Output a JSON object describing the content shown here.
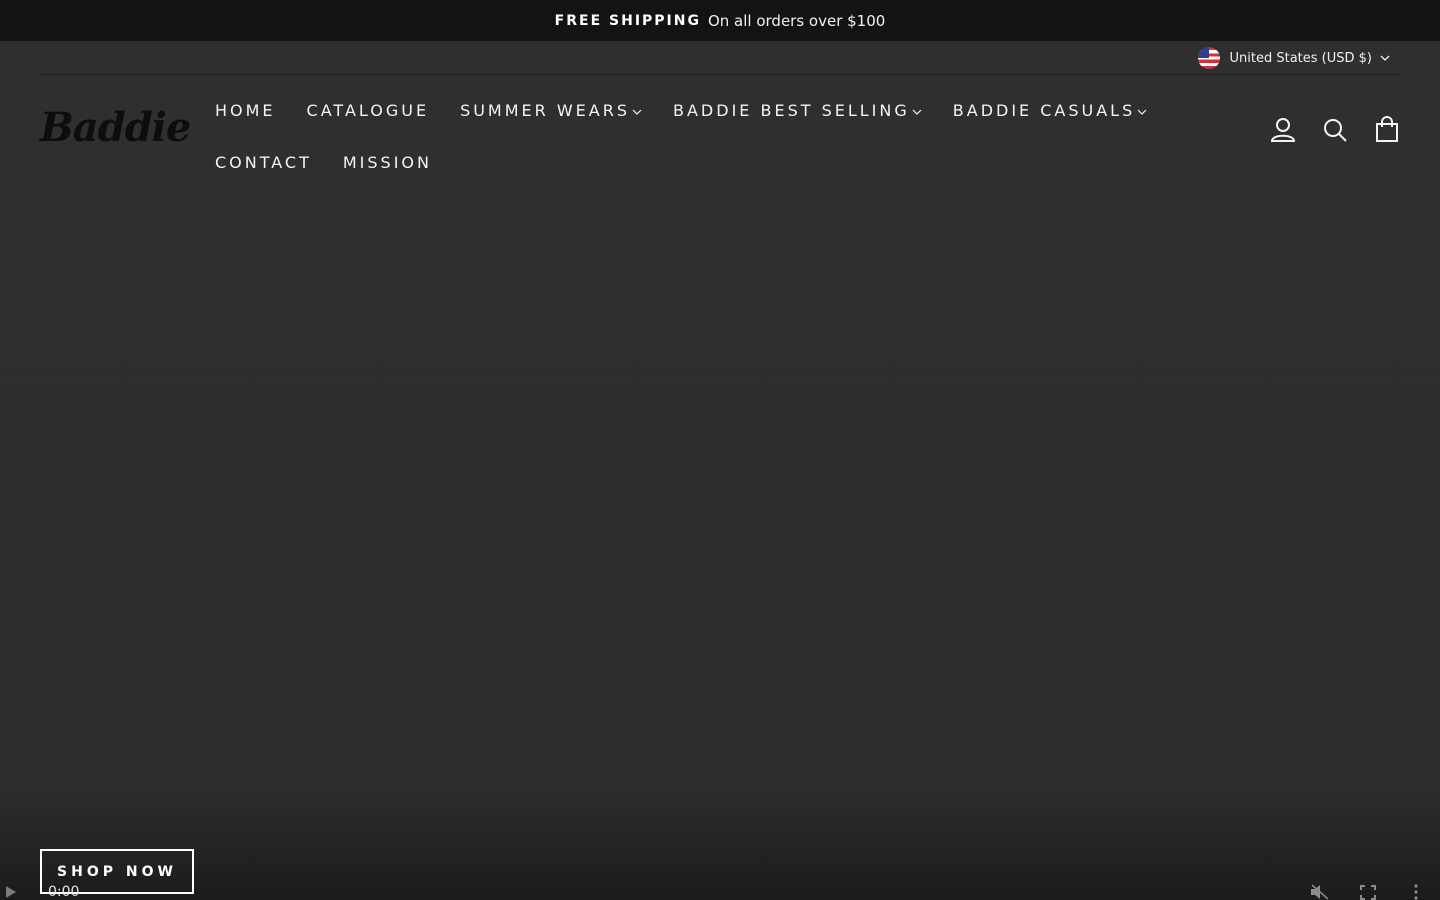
{
  "announcement": {
    "bold": "FREE SHIPPING",
    "text": "On all orders over $100"
  },
  "locale": {
    "label": "United States (USD $)",
    "icon": "us-flag-icon"
  },
  "brand": {
    "logo_text": "Baddie"
  },
  "nav": {
    "items": [
      {
        "label": "HOME",
        "dropdown": false
      },
      {
        "label": "CATALOGUE",
        "dropdown": false
      },
      {
        "label": "SUMMER WEARS",
        "dropdown": true
      },
      {
        "label": "BADDIE BEST SELLING",
        "dropdown": true
      },
      {
        "label": "BADDIE CASUALS",
        "dropdown": true
      },
      {
        "label": "CONTACT",
        "dropdown": false
      },
      {
        "label": "MISSION",
        "dropdown": false
      }
    ]
  },
  "header_icons": [
    "account-icon",
    "search-icon",
    "cart-icon"
  ],
  "hero": {
    "cta_label": "SHOP NOW"
  },
  "video": {
    "time": "0:00"
  },
  "colors": {
    "announcement_bg": "#131313",
    "page_bg": "#2e2e2e",
    "text": "#ffffff"
  }
}
